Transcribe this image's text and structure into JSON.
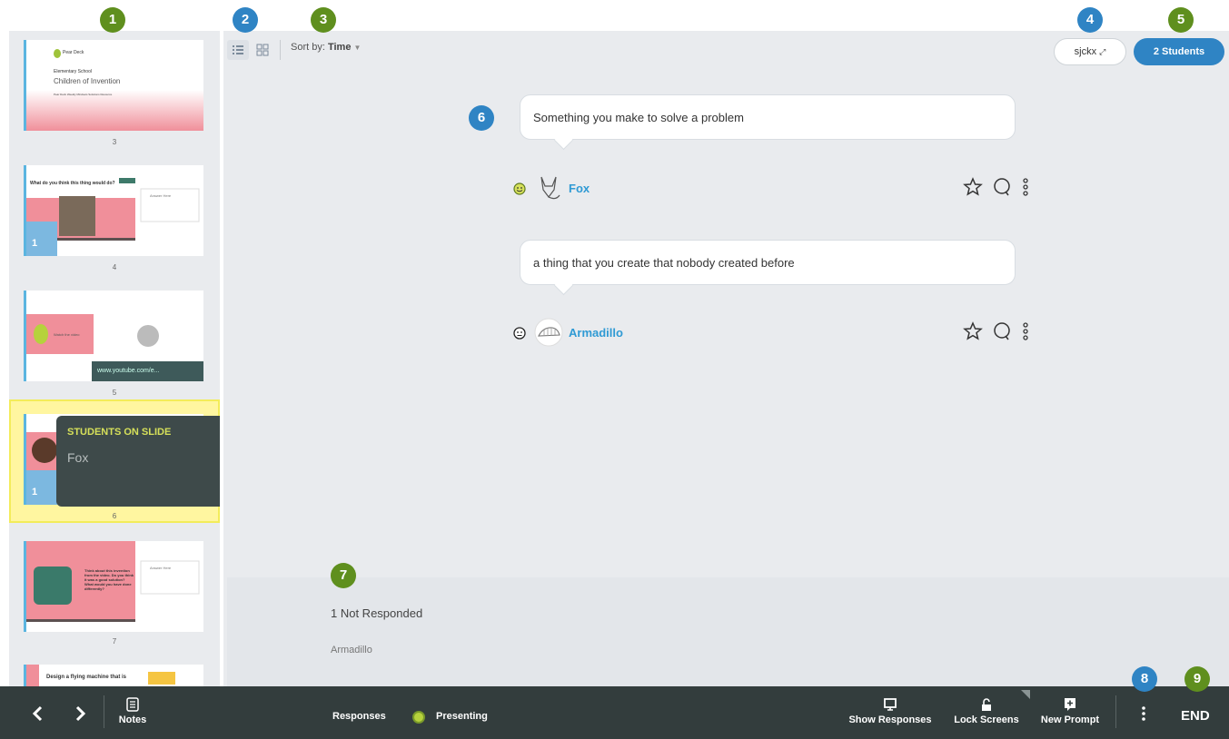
{
  "markers": [
    "1",
    "2",
    "3",
    "4",
    "5",
    "6",
    "7",
    "8",
    "9"
  ],
  "sidebar": {
    "slides": [
      {
        "number": "3",
        "brand": "Pear Deck",
        "subtitle": "Elementary School",
        "title": "Children of Invention",
        "footer": "Pear Deck Weekly Mindsets Solutions Resource"
      },
      {
        "number": "4",
        "title": "What do you think this thing would do?",
        "answer_label": "Answer Here",
        "avatar_count": "1"
      },
      {
        "number": "5",
        "caption": "Watch the video",
        "link": "www.youtube.com/e..."
      },
      {
        "number": "6",
        "avatar_count": "1"
      },
      {
        "number": "7",
        "question": "Think about this invention from the video. Do you think it was a good solution? What would you have done differently?",
        "answer_label": "Answer Here"
      },
      {
        "title": "Design a flying machine that is"
      }
    ],
    "tooltip": {
      "heading": "STUDENTS ON SLIDE",
      "student": "Fox"
    }
  },
  "toolbar": {
    "sort_label": "Sort by:",
    "sort_value": "Time"
  },
  "header": {
    "code": "sjckx",
    "students_label": "2 Students"
  },
  "responses": [
    {
      "text": "Something you make to solve a problem",
      "student": "Fox",
      "mood": "happy"
    },
    {
      "text": "a thing that you create that nobody created before",
      "student": "Armadillo",
      "mood": "neutral"
    }
  ],
  "not_responded": {
    "label": "1 Not Responded",
    "students": [
      "Armadillo"
    ]
  },
  "bottombar": {
    "notes": "Notes",
    "responses": "Responses",
    "presenting": "Presenting",
    "show_responses": "Show Responses",
    "lock_screens": "Lock Screens",
    "new_prompt": "New Prompt",
    "end": "END"
  },
  "colors": {
    "accent": "#2f84c4",
    "highlight": "#f3ec5a",
    "dark_bar": "#333d3d",
    "name_blue": "#2f9ad4",
    "presenting_dot": "#b6d23c"
  }
}
